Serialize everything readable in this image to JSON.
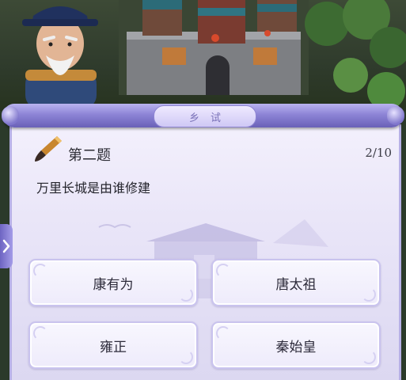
{
  "panel": {
    "title": "乡试",
    "question_number": "第二题",
    "progress": "2/10",
    "question": "万里长城是由谁修建"
  },
  "options": [
    {
      "label": "康有为"
    },
    {
      "label": "唐太祖"
    },
    {
      "label": "雍正"
    },
    {
      "label": "秦始皇"
    }
  ],
  "icons": {
    "panel_icon": "brush-icon",
    "side_tab": "chevron-right-icon"
  },
  "colors": {
    "scroll_accent": "#8d84d6",
    "paper": "#ece8f9",
    "text": "#2b2b33"
  }
}
